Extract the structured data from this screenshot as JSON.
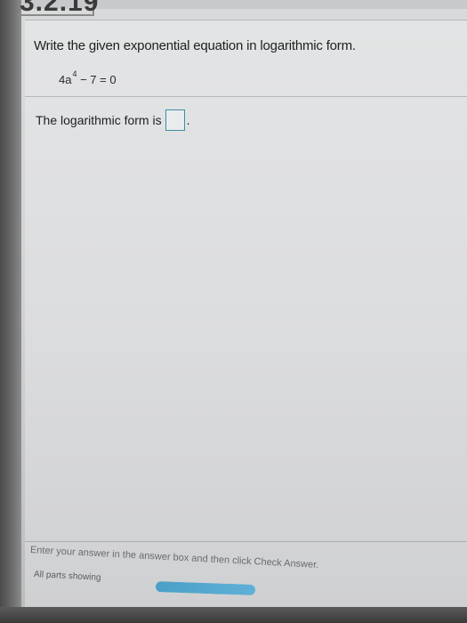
{
  "header": {
    "section_number": "3.2.19"
  },
  "question": {
    "instruction": "Write the given exponential equation in logarithmic form.",
    "equation_base": "4a",
    "equation_exponent": "4",
    "equation_rest": " − 7 = 0"
  },
  "answer": {
    "prompt": "The logarithmic form is",
    "value": "",
    "trailing": "."
  },
  "footer": {
    "hint": "Enter your answer in the answer box and then click Check Answer.",
    "parts_label": "All parts showing",
    "progress_fraction": 1.0
  },
  "colors": {
    "answer_box_border": "#3e8fa8",
    "progress_fill": "#4aa0c8"
  }
}
